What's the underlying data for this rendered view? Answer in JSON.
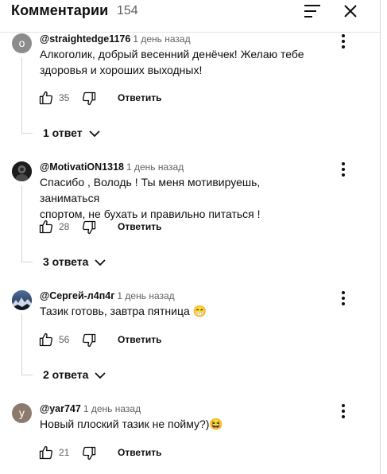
{
  "header": {
    "title": "Комментарии",
    "count": "154"
  },
  "comments": [
    {
      "avatar_letter": "o",
      "avatar_color": "#8c8c8c",
      "author": "@straightedge1176",
      "time": "1 день назад",
      "text": "Алкоголик, добрый весенний денёчек! Желаю тебе\nздоровья и хороших выходных!",
      "likes": "35",
      "reply_label": "Ответить",
      "replies_label": "1 ответ"
    },
    {
      "avatar_letter": "",
      "avatar_color": "#1c1c1c",
      "author": "@MotivatiON1318",
      "time": "1 день назад",
      "text": "Спасибо , Володь ! Ты меня мотивируешь, заниматься\nспортом, не бухать и правильно питаться !",
      "likes": "28",
      "reply_label": "Ответить",
      "replies_label": "3 ответа"
    },
    {
      "avatar_letter": "",
      "avatar_color": "#2b3e5a",
      "author": "@Сергей-л4п4г",
      "time": "1 день назад",
      "text": "Тазик готовь, завтра пятница 😁",
      "likes": "56",
      "reply_label": "Ответить",
      "replies_label": "2 ответа"
    },
    {
      "avatar_letter": "y",
      "avatar_color": "#8d7a6f",
      "author": "@yar747",
      "time": "1 день назад",
      "text": "Новый плоский тазик не пойму?)😆",
      "likes": "21",
      "reply_label": "Ответить",
      "replies_label": ""
    }
  ],
  "icons": {
    "sort": "sort-icon",
    "close": "close-icon",
    "more": "more-vert-icon",
    "like": "thumb-up-icon",
    "dislike": "thumb-down-icon",
    "chevron": "chevron-down-icon"
  }
}
